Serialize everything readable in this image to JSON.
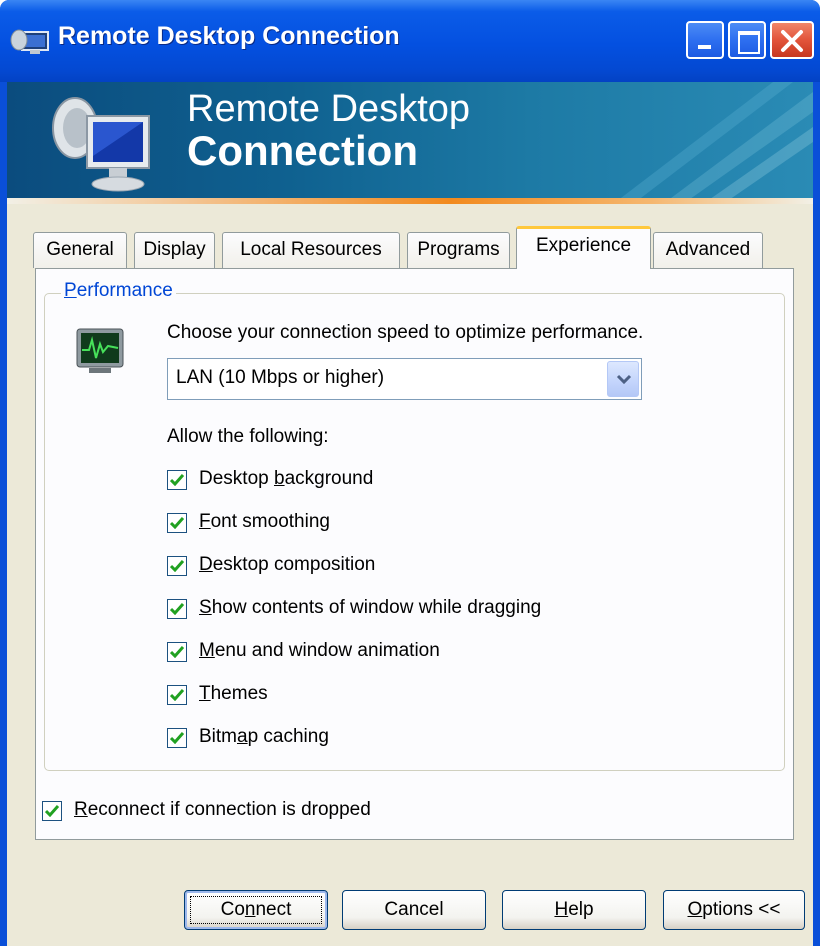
{
  "window": {
    "title": "Remote Desktop Connection"
  },
  "banner": {
    "line1": "Remote Desktop",
    "line2": "Connection"
  },
  "tabs": [
    {
      "label": "General"
    },
    {
      "label": "Display"
    },
    {
      "label": "Local Resources"
    },
    {
      "label": "Programs"
    },
    {
      "label": "Experience"
    },
    {
      "label": "Advanced"
    }
  ],
  "active_tab": "Experience",
  "performance": {
    "group_title": "Performance",
    "prompt": "Choose your connection speed to optimize performance.",
    "speed_selected": "LAN (10 Mbps or higher)",
    "allow_label": "Allow the following:",
    "options": [
      {
        "label": "Desktop background",
        "checked": true
      },
      {
        "label": "Font smoothing",
        "checked": true
      },
      {
        "label": "Desktop composition",
        "checked": true
      },
      {
        "label": "Show contents of window while dragging",
        "checked": true
      },
      {
        "label": "Menu and window animation",
        "checked": true
      },
      {
        "label": "Themes",
        "checked": true
      },
      {
        "label": "Bitmap caching",
        "checked": true
      }
    ]
  },
  "reconnect": {
    "label": "Reconnect if connection is dropped",
    "checked": true
  },
  "buttons": {
    "connect": "Connect",
    "cancel": "Cancel",
    "help": "Help",
    "options": "Options <<"
  },
  "colors": {
    "titlebar": "#0450e0",
    "client_bg": "#ece9d8",
    "group_title": "#0046d5",
    "banner": "#0f6190",
    "tab_highlight": "#ffc83c",
    "check": "#21a121"
  }
}
